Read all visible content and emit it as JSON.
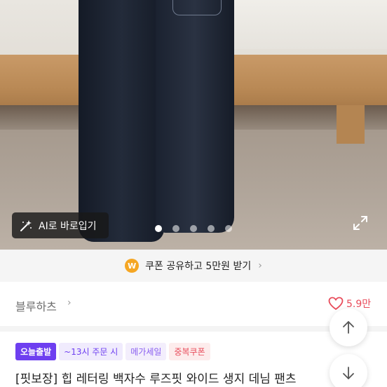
{
  "photo": {
    "ai_button_label": "AI로 바로입기",
    "wand_icon": "magic-wand-icon",
    "expand_icon": "expand-icon",
    "carousel": {
      "total": 5,
      "active_index": 0
    }
  },
  "coupon": {
    "badge": "W",
    "text": "쿠폰 공유하고 5만원 받기",
    "chevron": "›"
  },
  "shop": {
    "name": "블루하츠",
    "chevron": "›",
    "likes": "5.9만",
    "like_icon": "heart-icon"
  },
  "tags": [
    {
      "label": "오늘출발"
    },
    {
      "label": "~13시 주문 시"
    },
    {
      "label": "메가세일"
    },
    {
      "label": "중복쿠폰"
    }
  ],
  "product": {
    "title": "[핏보장] 힙 레터링 백자수 루즈핏 와이드 생지 데님 팬츠"
  },
  "fabs": {
    "up_icon": "arrow-up-icon",
    "down_icon": "arrow-down-icon"
  },
  "colors": {
    "accent_purple": "#6e3ff0",
    "like_red": "#e84b5a",
    "coin_orange": "#f5a623"
  }
}
